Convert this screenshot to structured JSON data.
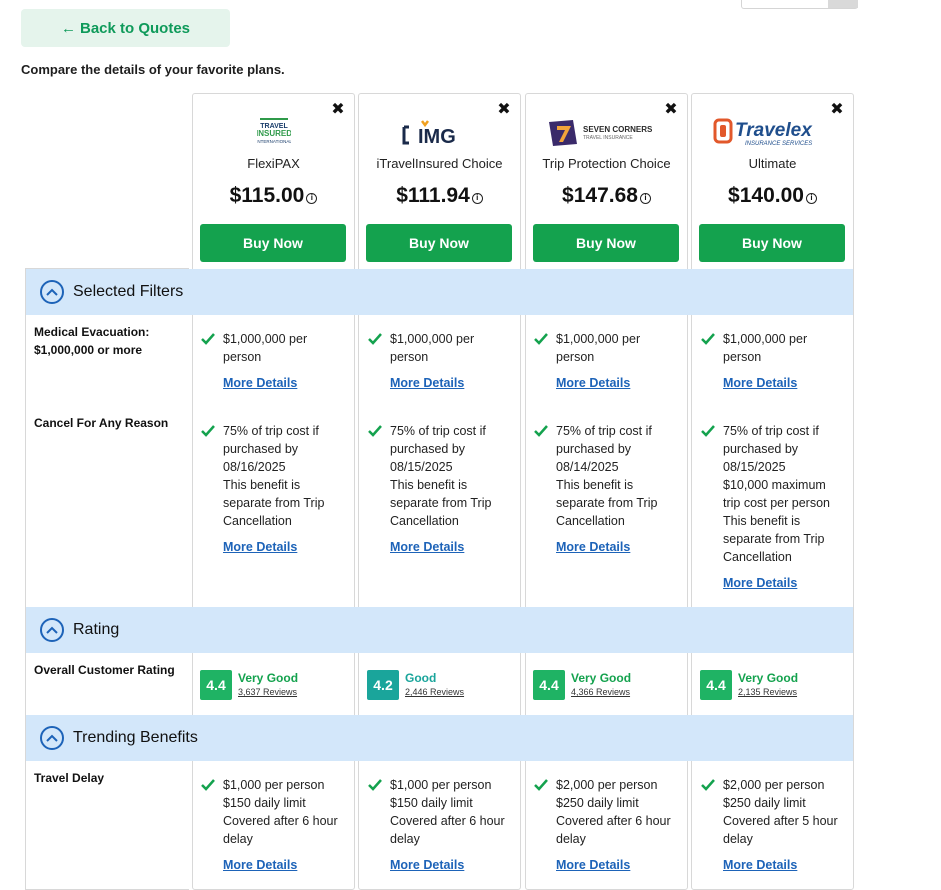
{
  "header": {
    "back_label": "Back to Quotes",
    "intro": "Compare the details of your favorite plans."
  },
  "colors": {
    "brand_green": "#14a24e",
    "section_band": "#d3e7fa",
    "link_blue": "#1d63b8",
    "rating_green": "#1fb364",
    "rating_teal": "#1aa59b"
  },
  "plans": [
    {
      "name": "FlexiPAX",
      "price": "$115.00",
      "buy_label": "Buy Now",
      "logo_text": "TRAVEL INSURED INTERNATIONAL"
    },
    {
      "name": "iTravelInsured Choice",
      "price": "$111.94",
      "buy_label": "Buy Now",
      "logo_text": "IMG"
    },
    {
      "name": "Trip Protection Choice",
      "price": "$147.68",
      "buy_label": "Buy Now",
      "logo_text": "SEVEN CORNERS",
      "logo_sub": "TRAVEL INSURANCE"
    },
    {
      "name": "Ultimate",
      "price": "$140.00",
      "buy_label": "Buy Now",
      "logo_text": "Travelex",
      "logo_sub": "INSURANCE SERVICES"
    }
  ],
  "sections": {
    "filters": "Selected Filters",
    "rating": "Rating",
    "trending": "Trending Benefits"
  },
  "rows": {
    "medical_label": "Medical Evacuation: $1,000,000 or more",
    "cfar_label": "Cancel For Any Reason",
    "rating_label": "Overall Customer Rating",
    "delay_label": "Travel Delay"
  },
  "more_details": "More Details",
  "medical": [
    "$1,000,000 per person",
    "$1,000,000 per person",
    "$1,000,000 per person",
    "$1,000,000 per person"
  ],
  "cfar": [
    [
      "75% of trip cost if purchased by 08/16/2025",
      "This benefit is separate from Trip Cancellation"
    ],
    [
      "75% of trip cost if purchased by 08/15/2025",
      "This benefit is separate from Trip Cancellation"
    ],
    [
      "75% of trip cost if purchased by 08/14/2025",
      "This benefit is separate from Trip Cancellation"
    ],
    [
      "75% of trip cost if purchased by 08/15/2025",
      "$10,000 maximum trip cost per person",
      "This benefit is separate from Trip Cancellation"
    ]
  ],
  "ratings": [
    {
      "score": "4.4",
      "label": "Very Good",
      "reviews": "3,637 Reviews"
    },
    {
      "score": "4.2",
      "label": "Good",
      "reviews": "2,446 Reviews"
    },
    {
      "score": "4.4",
      "label": "Very Good",
      "reviews": "4,366 Reviews"
    },
    {
      "score": "4.4",
      "label": "Very Good",
      "reviews": "2,135 Reviews"
    }
  ],
  "delay": [
    [
      "$1,000 per person",
      "$150 daily limit",
      "Covered after 6 hour delay"
    ],
    [
      "$1,000 per person",
      "$150 daily limit",
      "Covered after 6 hour delay"
    ],
    [
      "$2,000 per person",
      "$250 daily limit",
      "Covered after 6 hour delay"
    ],
    [
      "$2,000 per person",
      "$250 daily limit",
      "Covered after 5 hour delay"
    ]
  ]
}
